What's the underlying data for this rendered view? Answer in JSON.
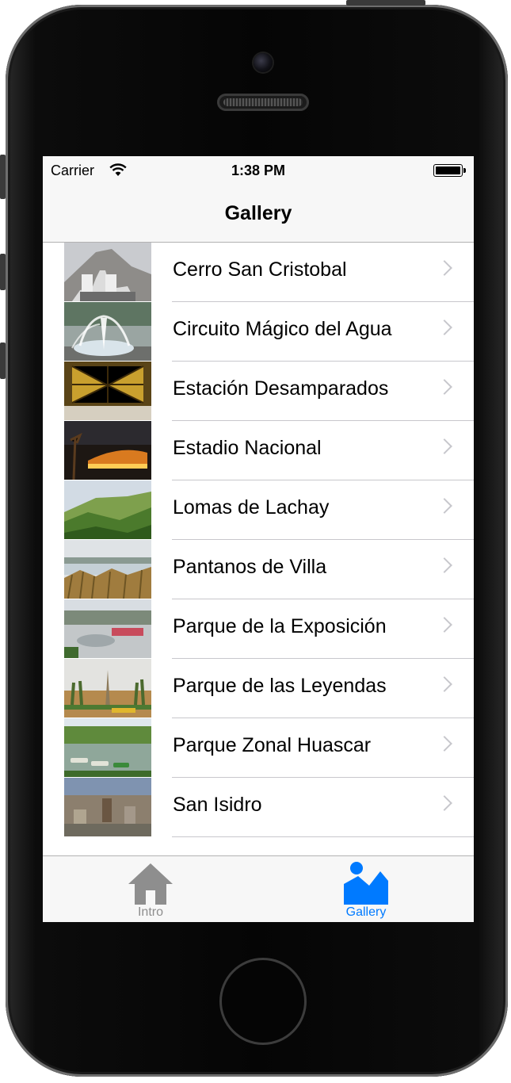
{
  "status_bar": {
    "carrier": "Carrier",
    "time": "1:38 PM"
  },
  "nav_bar": {
    "title": "Gallery"
  },
  "places": [
    {
      "label": "Cerro San Cristobal"
    },
    {
      "label": "Circuito Mágico del Agua"
    },
    {
      "label": "Estación Desamparados"
    },
    {
      "label": "Estadio Nacional"
    },
    {
      "label": "Lomas de Lachay"
    },
    {
      "label": "Pantanos de Villa"
    },
    {
      "label": "Parque de la Exposición"
    },
    {
      "label": "Parque de las Leyendas"
    },
    {
      "label": "Parque Zonal Huascar"
    },
    {
      "label": "San Isidro"
    }
  ],
  "tab_bar": {
    "tabs": [
      {
        "label": "Intro",
        "icon": "home-icon",
        "selected": false
      },
      {
        "label": "Gallery",
        "icon": "gallery-icon",
        "selected": true
      }
    ]
  },
  "colors": {
    "accent": "#007aff",
    "inactive": "#8e8e8e"
  }
}
